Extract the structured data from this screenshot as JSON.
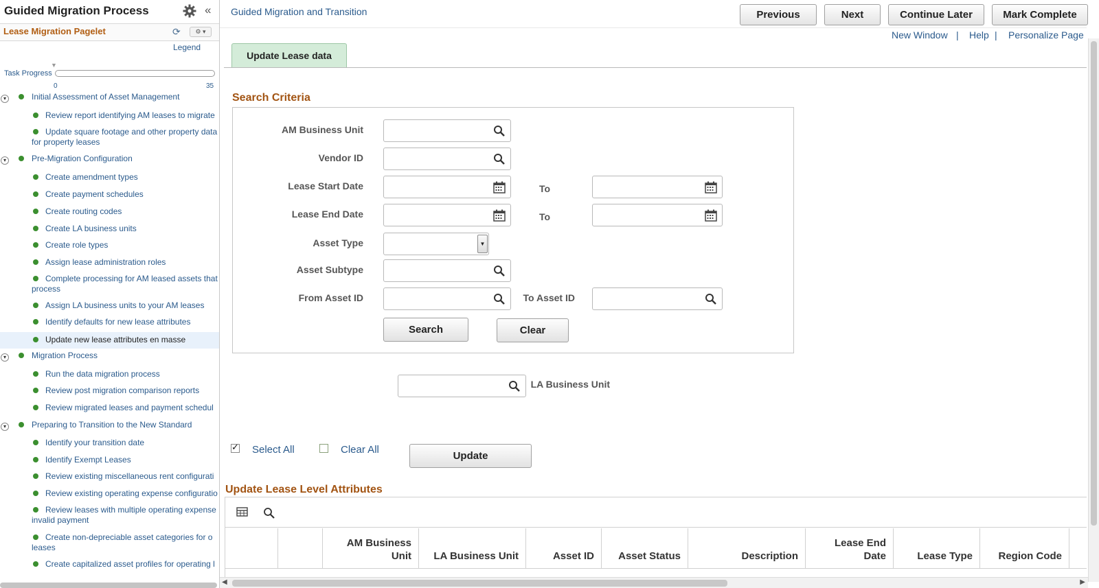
{
  "left_panel": {
    "title": "Guided Migration Process",
    "collapse_glyph": "«",
    "pagelet_title": "Lease Migration Pagelet",
    "legend": "Legend",
    "task_progress_label": "Task Progress",
    "progress_min": "0",
    "progress_max": "35",
    "progress_value": 0,
    "items": [
      {
        "label": "Initial Assessment of Asset Management",
        "level": 0
      },
      {
        "label": "Review report identifying AM leases to migrate",
        "level": 1
      },
      {
        "label": "Update square footage and other property data for property leases",
        "level": 1
      },
      {
        "label": "Pre-Migration Configuration",
        "level": 0
      },
      {
        "label": "Create amendment types",
        "level": 1
      },
      {
        "label": "Create payment schedules",
        "level": 1
      },
      {
        "label": "Create routing codes",
        "level": 1
      },
      {
        "label": "Create LA business units",
        "level": 1
      },
      {
        "label": "Create role types",
        "level": 1
      },
      {
        "label": "Assign lease administration roles",
        "level": 1
      },
      {
        "label": "Complete processing for AM leased assets that process",
        "level": 1
      },
      {
        "label": "Assign LA business units to your AM leases",
        "level": 1
      },
      {
        "label": "Identify defaults for new lease attributes",
        "level": 1
      },
      {
        "label": "Update new lease attributes en masse",
        "level": 1,
        "selected": true
      },
      {
        "label": "Migration Process",
        "level": 0
      },
      {
        "label": "Run the data migration process",
        "level": 1
      },
      {
        "label": "Review post migration comparison reports",
        "level": 1
      },
      {
        "label": "Review migrated leases and payment schedul",
        "level": 1
      },
      {
        "label": "Preparing to Transition to the New Standard",
        "level": 0
      },
      {
        "label": "Identify your transition date",
        "level": 1
      },
      {
        "label": "Identify Exempt Leases",
        "level": 1
      },
      {
        "label": "Review existing miscellaneous rent configurati",
        "level": 1
      },
      {
        "label": "Review existing operating expense configuratio",
        "level": 1
      },
      {
        "label": "Review leases with multiple operating expense invalid payment",
        "level": 1
      },
      {
        "label": "Create non-depreciable asset categories for o leases",
        "level": 1
      },
      {
        "label": "Create capitalized asset profiles for operating l",
        "level": 1
      }
    ]
  },
  "main": {
    "breadcrumb": "Guided Migration and Transition",
    "buttons": {
      "previous": "Previous",
      "next": "Next",
      "continue_later": "Continue Later",
      "mark_complete": "Mark Complete"
    },
    "links": {
      "new_window": "New Window",
      "help": "Help",
      "personalize": "Personalize Page",
      "separator": "|"
    },
    "tab": "Update Lease data",
    "search_criteria": {
      "title": "Search Criteria",
      "am_business_unit": "AM Business Unit",
      "vendor_id": "Vendor ID",
      "lease_start_date": "Lease Start Date",
      "lease_end_date": "Lease End Date",
      "to": "To",
      "asset_type": "Asset Type",
      "asset_subtype": "Asset Subtype",
      "from_asset_id": "From Asset ID",
      "to_asset_id": "To Asset ID",
      "search_button": "Search",
      "clear_button": "Clear"
    },
    "la_business_unit": "LA Business Unit",
    "select_all": "Select All",
    "clear_all": "Clear All",
    "update_button": "Update",
    "attributes_title": "Update Lease Level Attributes",
    "grid_headers": [
      "",
      "",
      "AM Business Unit",
      "LA Business Unit",
      "Asset ID",
      "Asset Status",
      "Description",
      "Lease End Date",
      "Lease Type",
      "Region Code"
    ]
  },
  "colors": {
    "accent_orange": "#a25413",
    "link_blue": "#2a5a8c",
    "tab_green": "#d4ecd9",
    "status_dot_green": "#3b8f2f"
  }
}
